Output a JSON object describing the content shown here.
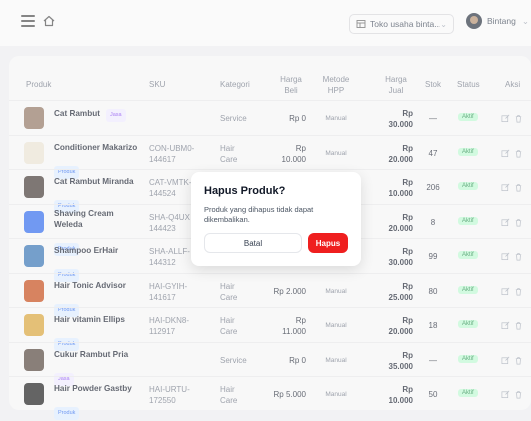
{
  "header": {
    "store": "Toko usaha binta...",
    "user": "Bintang"
  },
  "table": {
    "columns": {
      "produk": "Produk",
      "sku": "SKU",
      "kategori": "Kategori",
      "harga_beli": "Harga\nBeli",
      "metode_hpp": "Metode\nHPP",
      "harga_jual": "Harga\nJual",
      "stok": "Stok",
      "status": "Status",
      "aksi": "Aksi"
    },
    "rows": [
      {
        "name": "Cat Rambut",
        "tag": "Jasa",
        "sku": "",
        "kategori": "Service",
        "harga_beli": "Rp 0",
        "metode": "Manual",
        "harga_jual": "Rp\n30.000",
        "stok": "—",
        "status": "Aktif"
      },
      {
        "name": "Conditioner Makarizo",
        "tag": "Produk",
        "sku": "CON-UBM0-\n144617",
        "kategori": "Hair\nCare",
        "harga_beli": "Rp\n10.000",
        "metode": "Manual",
        "harga_jual": "Rp\n20.000",
        "stok": "47",
        "status": "Aktif"
      },
      {
        "name": "Cat Rambut Miranda",
        "tag": "Produk",
        "sku": "CAT-VMTK-\n144524",
        "kategori": "",
        "harga_beli": "",
        "metode": "",
        "harga_jual": "Rp\n10.000",
        "stok": "206",
        "status": "Aktif"
      },
      {
        "name": "Shaving Cream\nWeleda",
        "tag": "Produk",
        "sku": "SHA-Q4UX\n144423",
        "kategori": "",
        "harga_beli": "",
        "metode": "",
        "harga_jual": "Rp\n20.000",
        "stok": "8",
        "status": "Aktif"
      },
      {
        "name": "Shampoo ErHair",
        "tag": "Produk",
        "sku": "SHA-ALLF-\n144312",
        "kategori": "",
        "harga_beli": "",
        "metode": "",
        "harga_jual": "Rp\n30.000",
        "stok": "99",
        "status": "Aktif"
      },
      {
        "name": "Hair Tonic Advisor",
        "tag": "Produk",
        "sku": "HAI-GYIH-\n141617",
        "kategori": "Hair\nCare",
        "harga_beli": "Rp 2.000",
        "metode": "Manual",
        "harga_jual": "Rp\n25.000",
        "stok": "80",
        "status": "Aktif"
      },
      {
        "name": "Hair vitamin Ellips",
        "tag": "Produk",
        "sku": "HAI-DKN8-\n112917",
        "kategori": "Hair\nCare",
        "harga_beli": "Rp\n11.000",
        "metode": "Manual",
        "harga_jual": "Rp\n20.000",
        "stok": "18",
        "status": "Aktif"
      },
      {
        "name": "Cukur Rambut Pria",
        "tag": "Jasa",
        "sku": "",
        "kategori": "Service",
        "harga_beli": "Rp 0",
        "metode": "Manual",
        "harga_jual": "Rp\n35.000",
        "stok": "—",
        "status": "Aktif"
      },
      {
        "name": "Hair Powder Gastby",
        "tag": "Produk",
        "sku": "HAI-URTU-\n172550",
        "kategori": "Hair\nCare",
        "harga_beli": "Rp 5.000",
        "metode": "Manual",
        "harga_jual": "Rp\n10.000",
        "stok": "50",
        "status": "Aktif"
      }
    ]
  },
  "modal": {
    "title": "Hapus Produk?",
    "message": "Produk yang dihapus tidak dapat dikembalikan.",
    "cancel_label": "Batal",
    "confirm_label": "Hapus"
  },
  "colors": {
    "danger": "#ef1f1f",
    "status_green": "#bbf7d0",
    "tag_produk": "#dbeafe",
    "tag_jasa": "#ede9fe"
  }
}
